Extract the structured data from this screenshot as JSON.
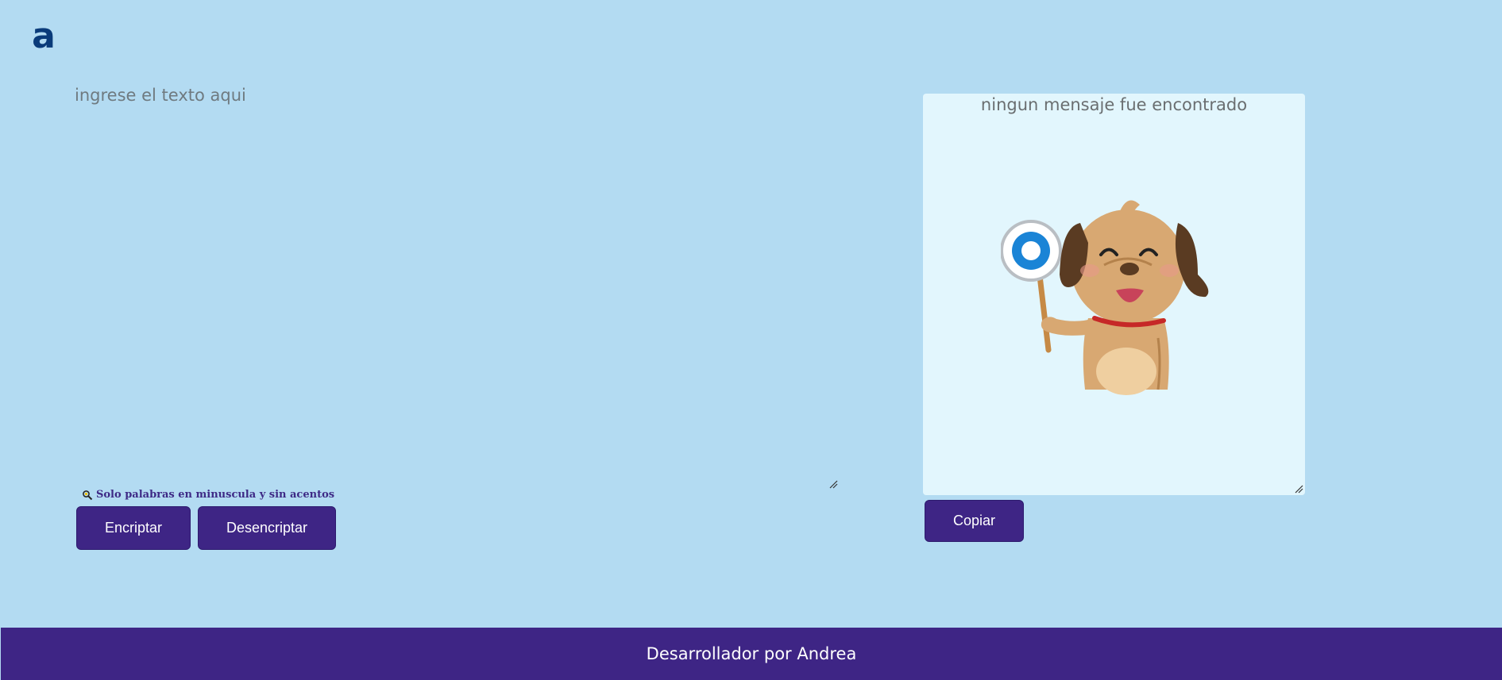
{
  "header": {
    "logo_text": "a"
  },
  "input": {
    "placeholder": "ingrese el texto aqui",
    "value": ""
  },
  "hint": {
    "icon": "magnifier-icon",
    "text": "Solo palabras en minuscula y sin acentos"
  },
  "buttons": {
    "encrypt_label": "Encriptar",
    "decrypt_label": "Desencriptar",
    "copy_label": "Copiar"
  },
  "output": {
    "message": "ningun mensaje fue encontrado",
    "illustration": "dog-holding-circle-sign-image"
  },
  "footer": {
    "text": "Desarrollador por Andrea"
  },
  "colors": {
    "background": "#b3dbf2",
    "accent": "#3e2585",
    "panel": "#e2f6fd",
    "logo": "#0a3b7a"
  }
}
